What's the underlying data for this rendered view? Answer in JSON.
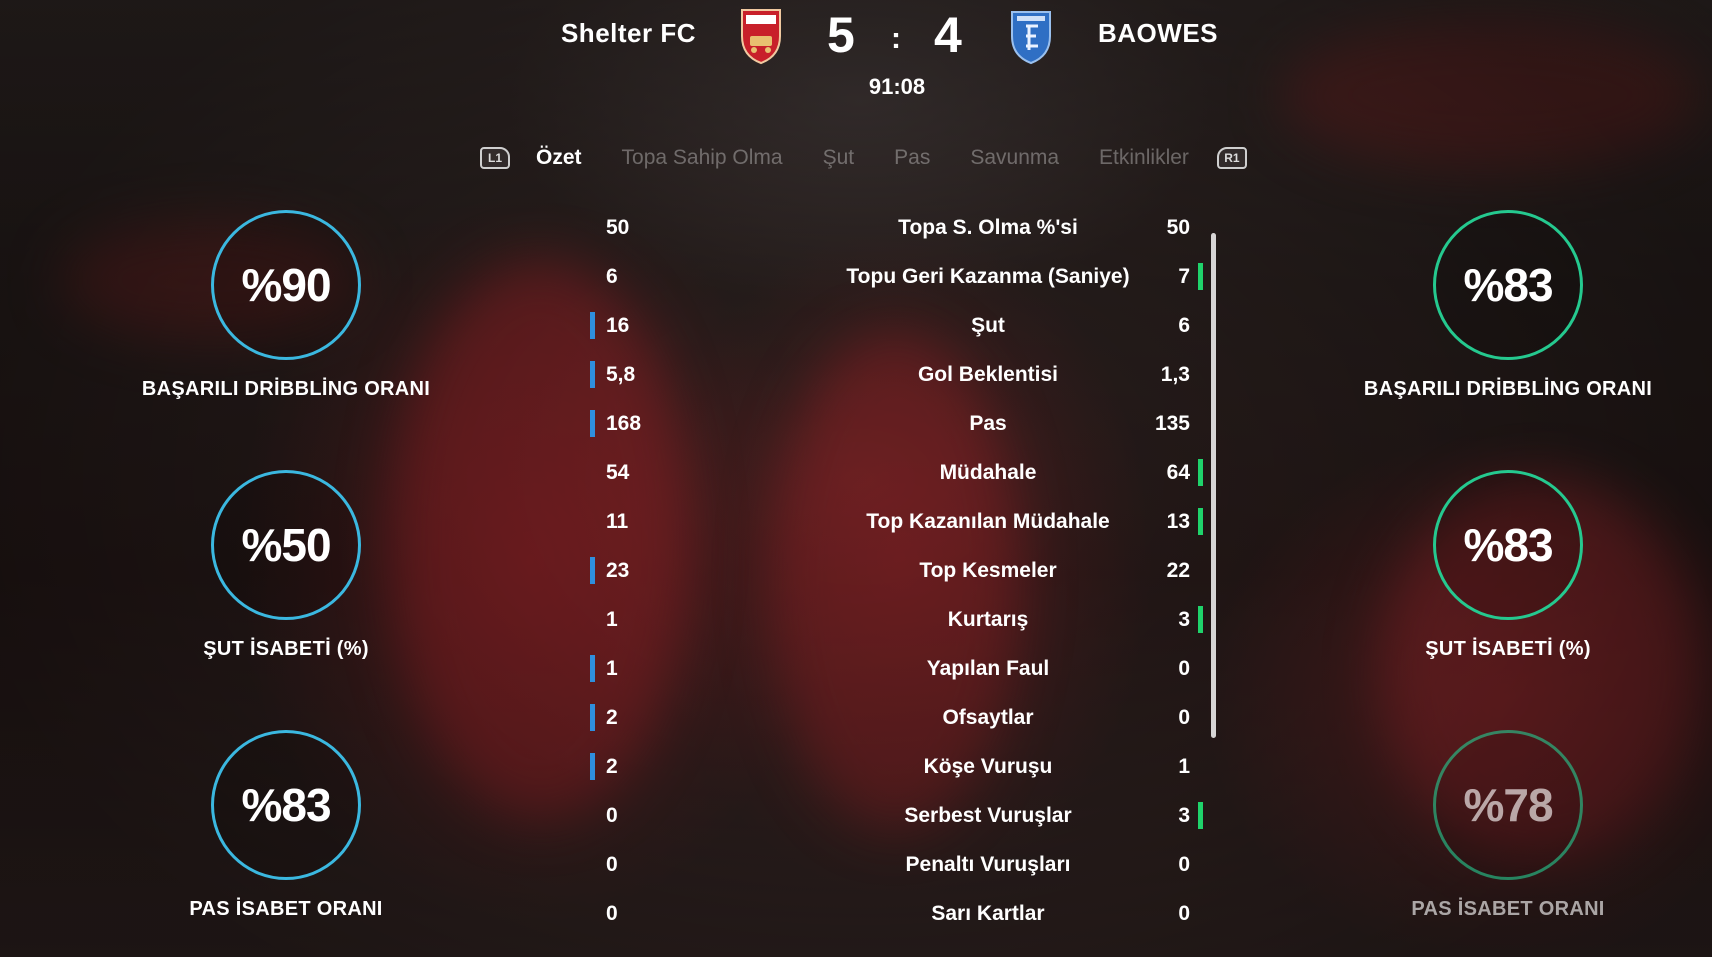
{
  "match": {
    "home_team": "Shelter FC",
    "away_team": "BAOWES",
    "home_score": "5",
    "score_separator": ":",
    "away_score": "4",
    "clock": "91:08"
  },
  "tabs": {
    "left_bumper": "L1",
    "right_bumper": "R1",
    "items": [
      {
        "label": "Özet",
        "active": true
      },
      {
        "label": "Topa Sahip Olma",
        "active": false
      },
      {
        "label": "Şut",
        "active": false
      },
      {
        "label": "Pas",
        "active": false
      },
      {
        "label": "Savunma",
        "active": false
      },
      {
        "label": "Etkinlikler",
        "active": false
      }
    ]
  },
  "home_rings": [
    {
      "value": "%90",
      "label": "BAŞARILI DRİBBLİNG ORANI"
    },
    {
      "value": "%50",
      "label": "ŞUT İSABETİ (%)"
    },
    {
      "value": "%83",
      "label": "PAS İSABET ORANI"
    }
  ],
  "away_rings": [
    {
      "value": "%83",
      "label": "BAŞARILI DRİBBLİNG ORANI"
    },
    {
      "value": "%83",
      "label": "ŞUT İSABETİ (%)"
    },
    {
      "value": "%78",
      "label": "PAS İSABET ORANI"
    }
  ],
  "stats": [
    {
      "home": "50",
      "label": "Topa S. Olma %'si",
      "away": "50"
    },
    {
      "home": "6",
      "label": "Topu Geri Kazanma (Saniye)",
      "away": "7"
    },
    {
      "home": "16",
      "label": "Şut",
      "away": "6"
    },
    {
      "home": "5,8",
      "label": "Gol Beklentisi",
      "away": "1,3"
    },
    {
      "home": "168",
      "label": "Pas",
      "away": "135"
    },
    {
      "home": "54",
      "label": "Müdahale",
      "away": "64"
    },
    {
      "home": "11",
      "label": "Top Kazanılan Müdahale",
      "away": "13"
    },
    {
      "home": "23",
      "label": "Top Kesmeler",
      "away": "22"
    },
    {
      "home": "1",
      "label": "Kurtarış",
      "away": "3"
    },
    {
      "home": "1",
      "label": "Yapılan Faul",
      "away": "0"
    },
    {
      "home": "2",
      "label": "Ofsaytlar",
      "away": "0"
    },
    {
      "home": "2",
      "label": "Köşe Vuruşu",
      "away": "1"
    },
    {
      "home": "0",
      "label": "Serbest Vuruşlar",
      "away": "3"
    },
    {
      "home": "0",
      "label": "Penaltı Vuruşları",
      "away": "0"
    },
    {
      "home": "0",
      "label": "Sarı Kartlar",
      "away": "0"
    }
  ],
  "colors": {
    "home_accent": "#3bb8e0",
    "home_lead_bar": "#2f8fde",
    "away_accent": "#25c98f",
    "away_lead_bar": "#1fd36b",
    "home_crest": "#c8202a",
    "away_crest": "#2f6fc4"
  }
}
